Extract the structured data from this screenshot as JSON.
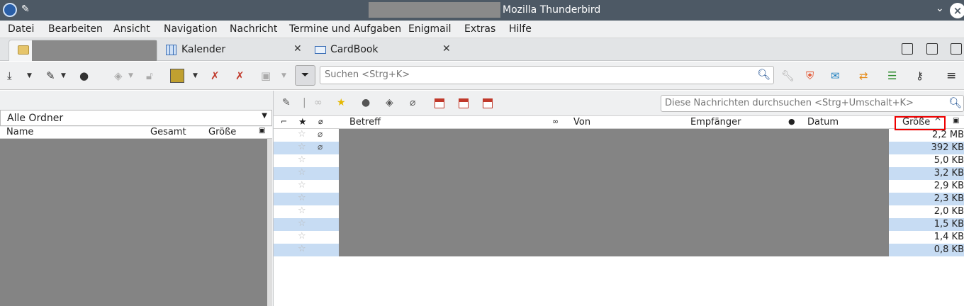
{
  "window": {
    "title": "Mozilla Thunderbird"
  },
  "menu": [
    "Datei",
    "Bearbeiten",
    "Ansicht",
    "Navigation",
    "Nachricht",
    "Termine und Aufgaben",
    "Enigmail",
    "Extras",
    "Hilfe"
  ],
  "tabs": [
    {
      "label": "",
      "icon": "folder-icon"
    },
    {
      "label": "Kalender",
      "icon": "calendar-icon"
    },
    {
      "label": "CardBook",
      "icon": "card-icon"
    }
  ],
  "toolbar": {
    "search_placeholder": "Suchen <Strg+K>"
  },
  "folder_pane": {
    "selector_value": "Alle Ordner",
    "columns": [
      "Name",
      "Gesamt",
      "Größe"
    ]
  },
  "message_pane": {
    "search_placeholder": "Diese Nachrichten durchsuchen <Strg+Umschalt+K>",
    "columns": {
      "subject": "Betreff",
      "from": "Von",
      "recipient": "Empfänger",
      "date": "Datum",
      "size": "Größe"
    },
    "rows": [
      {
        "size": "2,2 MB",
        "attachment": true
      },
      {
        "size": "392 KB",
        "attachment": true
      },
      {
        "size": "5,0 KB",
        "attachment": false
      },
      {
        "size": "3,2 KB",
        "attachment": false
      },
      {
        "size": "2,9 KB",
        "attachment": false
      },
      {
        "size": "2,3 KB",
        "attachment": false
      },
      {
        "size": "2,0 KB",
        "attachment": false
      },
      {
        "size": "1,5 KB",
        "attachment": false
      },
      {
        "size": "1,4 KB",
        "attachment": false
      },
      {
        "size": "0,8 KB",
        "attachment": false
      }
    ]
  },
  "colors": {
    "titlebar": "#4d5965",
    "row_alt": "#c7dcf3",
    "redaction": "#848484",
    "highlight": "#ee0000"
  }
}
